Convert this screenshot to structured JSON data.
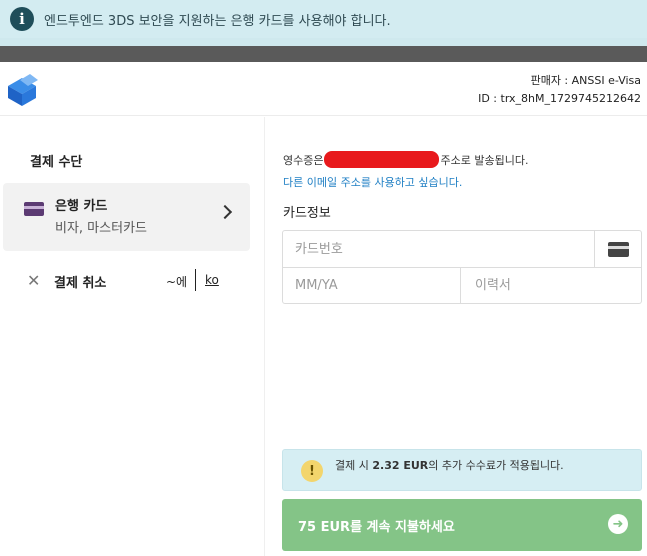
{
  "banner": {
    "icon": "info-icon",
    "info_glyph": "i",
    "text": "엔드투엔드 3DS 보안을 지원하는 은행 카드를 사용해야 합니다."
  },
  "header": {
    "merchant": "판매자 : ANSSI e-Visa",
    "transaction_id": "ID : trx_8hM_1729745212642"
  },
  "payment_methods": {
    "title": "결제 수단",
    "items": [
      {
        "name": "은행 카드",
        "sub": "비자, 마스터카드"
      }
    ],
    "cancel_label": "결제 취소",
    "lang_option": "~에",
    "lang_current": "ko"
  },
  "card_form": {
    "receipt_prefix": "영수증은",
    "receipt_suffix": "주소로 발송됩니다.",
    "other_email_link": "다른 이메일 주소를 사용하고 싶습니다.",
    "title": "카드정보",
    "card_number_placeholder": "카드번호",
    "expiry_placeholder": "MM/YA",
    "cvc_placeholder": "이력서"
  },
  "fee_notice": {
    "prefix": "결제 시",
    "amount": "2.32 EUR",
    "suffix": "의 추가 수수료가 적용됩니다.",
    "icon_glyph": "!"
  },
  "pay_button": {
    "label": "75 EUR를 계속 지불하세요",
    "arrow_glyph": "➜"
  },
  "colors": {
    "banner_bg": "#d3ecf1",
    "pay_button": "#84c487",
    "redaction": "#e8191c",
    "link": "#1f7fc4"
  }
}
